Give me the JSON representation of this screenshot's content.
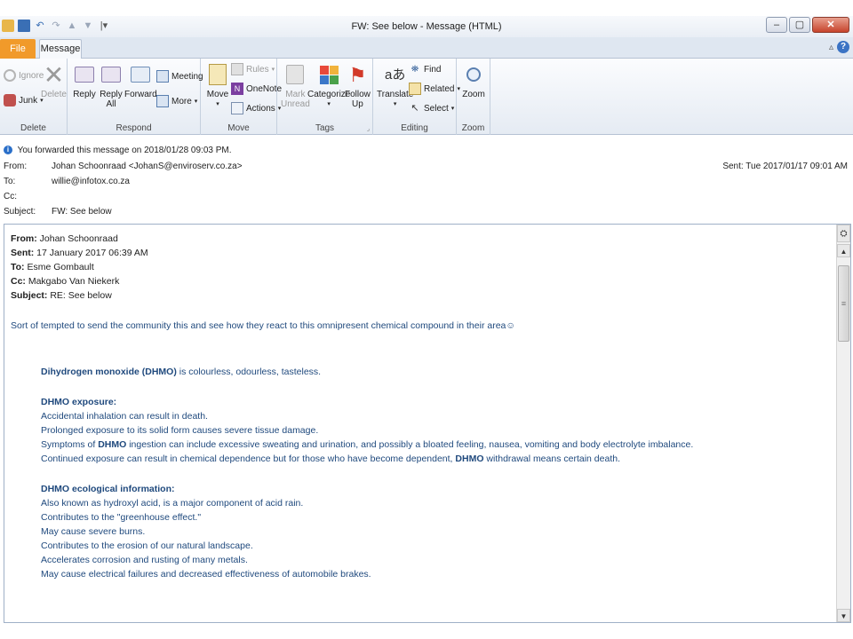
{
  "window": {
    "title": "FW: See below  -  Message (HTML)",
    "controls": {
      "minimize": "–",
      "maximize": "▢",
      "close": "✕"
    }
  },
  "quick_access": [
    "save-icon",
    "undo-icon",
    "redo-icon",
    "up-icon",
    "down-icon",
    "customize-icon"
  ],
  "tabs": {
    "file": "File",
    "message": "Message"
  },
  "ribbon": {
    "delete": {
      "label": "Delete",
      "ignore": "Ignore",
      "junk": "Junk",
      "delete_btn": "Delete"
    },
    "respond": {
      "label": "Respond",
      "reply": "Reply",
      "reply_all_1": "Reply",
      "reply_all_2": "All",
      "forward": "Forward",
      "meeting": "Meeting",
      "more": "More"
    },
    "move": {
      "label": "Move",
      "move_btn": "Move",
      "rules": "Rules",
      "onenote": "OneNote",
      "actions": "Actions"
    },
    "tags": {
      "label": "Tags",
      "mark_1": "Mark",
      "mark_2": "Unread",
      "categorize": "Categorize",
      "follow_1": "Follow",
      "follow_2": "Up"
    },
    "editing": {
      "label": "Editing",
      "translate": "Translate",
      "find": "Find",
      "related": "Related",
      "select": "Select"
    },
    "zoom": {
      "label": "Zoom",
      "zoom_btn": "Zoom"
    }
  },
  "header": {
    "info": "You forwarded this message on 2018/01/28 09:03 PM.",
    "from_label": "From:",
    "from_value": "Johan Schoonraad <JohanS@enviroserv.co.za>",
    "to_label": "To:",
    "to_value": "willie@infotox.co.za",
    "cc_label": "Cc:",
    "cc_value": "",
    "subject_label": "Subject:",
    "subject_value": "FW: See below",
    "sent": "Sent:   Tue 2017/01/17 09:01 AM"
  },
  "body": {
    "from_label": "From:",
    "from_value": " Johan Schoonraad",
    "sent_label": "Sent:",
    "sent_value": " 17 January 2017 06:39 AM",
    "to_label": "To:",
    "to_value": " Esme Gombault",
    "cc_label": "Cc:",
    "cc_value": " Makgabo Van Niekerk",
    "subject_label": "Subject:",
    "subject_value": " RE: See below",
    "intro": "Sort of tempted to send the community this and see how they react to this omnipresent chemical compound in their area☺",
    "dhmo_bold": "Dihydrogen monoxide (DHMO)",
    "dhmo_rest": " is colourless, odourless, tasteless.",
    "exposure_heading": "DHMO exposure:",
    "exposure_1": "Accidental inhalation  can result in death.",
    "exposure_2": "Prolonged exposure to its solid form causes severe tissue damage.",
    "exposure_3_a": "Symptoms of ",
    "exposure_3_b": "DHMO",
    "exposure_3_c": " ingestion can include excessive sweating and urination, and possibly a bloated feeling, nausea, vomiting and body electrolyte imbalance.",
    "exposure_4_a": "Continued exposure can result  in chemical dependence but for those who have become dependent, ",
    "exposure_4_b": "DHMO",
    "exposure_4_c": " withdrawal means certain death.",
    "eco_heading": "DHMO ecological information:",
    "eco_1": "Also known as hydroxyl acid, is a major component of acid rain.",
    "eco_2": "Contributes to the \"greenhouse effect.\"",
    "eco_3": "May cause severe burns.",
    "eco_4": "Contributes to the erosion of our natural landscape.",
    "eco_5": "Accelerates corrosion and rusting of many metals.",
    "eco_6": "May cause electrical failures and decreased effectiveness of automobile brakes."
  }
}
